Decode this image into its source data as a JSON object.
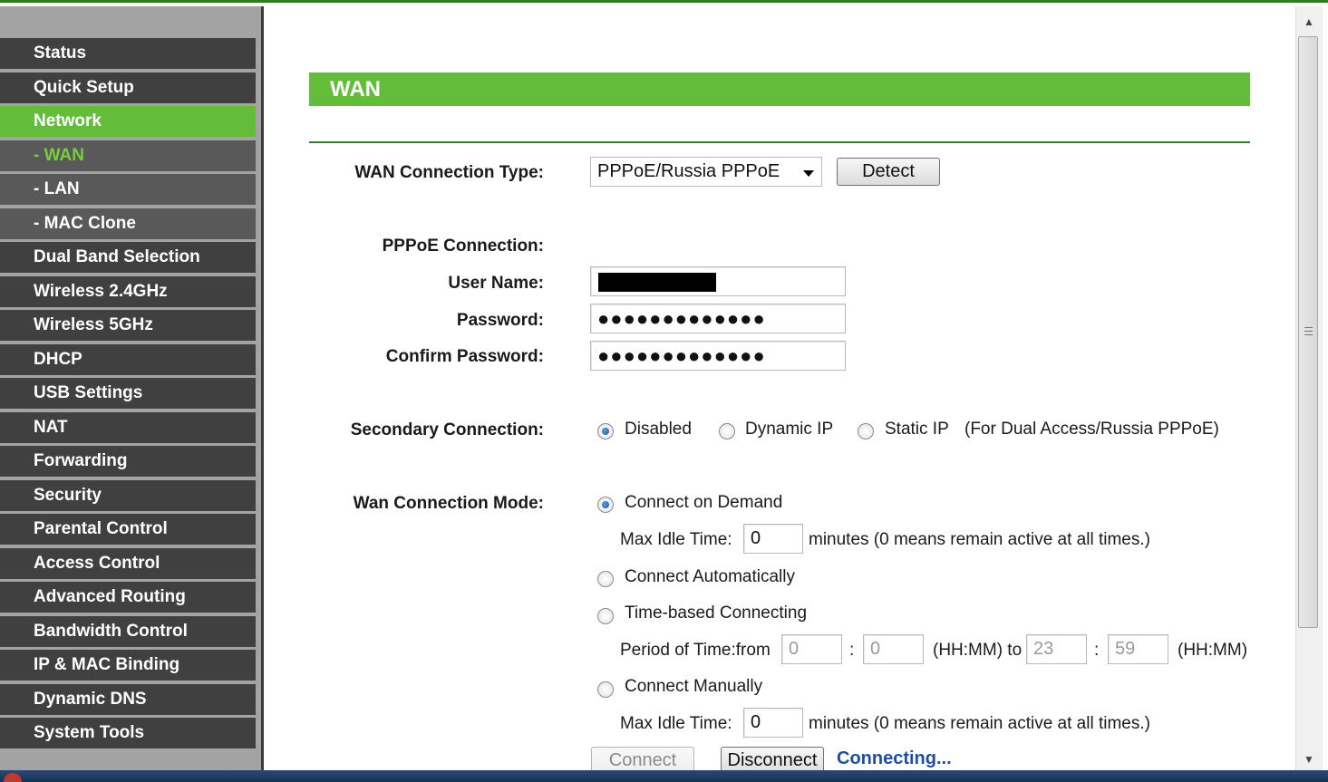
{
  "sidebar": {
    "items": [
      {
        "label": "Status"
      },
      {
        "label": "Quick Setup"
      },
      {
        "label": "Network",
        "state": "active"
      },
      {
        "label": "- WAN",
        "state": "current-sub"
      },
      {
        "label": "- LAN"
      },
      {
        "label": "- MAC Clone"
      },
      {
        "label": "Dual Band Selection"
      },
      {
        "label": "Wireless 2.4GHz"
      },
      {
        "label": "Wireless 5GHz"
      },
      {
        "label": "DHCP"
      },
      {
        "label": "USB Settings"
      },
      {
        "label": "NAT"
      },
      {
        "label": "Forwarding"
      },
      {
        "label": "Security"
      },
      {
        "label": "Parental Control"
      },
      {
        "label": "Access Control"
      },
      {
        "label": "Advanced Routing"
      },
      {
        "label": "Bandwidth Control"
      },
      {
        "label": "IP & MAC Binding"
      },
      {
        "label": "Dynamic DNS"
      },
      {
        "label": "System Tools"
      }
    ]
  },
  "page": {
    "title": "WAN",
    "wan_type_label": "WAN Connection Type:",
    "wan_type_value": "PPPoE/Russia PPPoE",
    "detect_button": "Detect",
    "pppoe_label": "PPPoE Connection:",
    "username_label": "User Name:",
    "password_label": "Password:",
    "password_value": "●●●●●●●●●●●●●",
    "confirm_label": "Confirm Password:",
    "confirm_value": "●●●●●●●●●●●●●",
    "secondary_label": "Secondary Connection:",
    "secondary_options": [
      "Disabled",
      "Dynamic IP",
      "Static IP"
    ],
    "secondary_selected": "Disabled",
    "secondary_note": "(For Dual Access/Russia PPPoE)",
    "mode_label": "Wan Connection Mode:",
    "mode_options": [
      "Connect on Demand",
      "Connect Automatically",
      "Time-based Connecting",
      "Connect Manually"
    ],
    "mode_selected": "Connect on Demand",
    "max_idle_label": "Max Idle Time:",
    "max_idle_value_1": "0",
    "max_idle_value_2": "0",
    "minutes_note": "minutes (0 means remain active at all times.)",
    "period_label": "Period of Time:from",
    "from_hh": "0",
    "from_mm": "0",
    "to_hh": "23",
    "to_mm": "59",
    "colon": ":",
    "hhmm_to": "(HH:MM) to",
    "hhmm": "(HH:MM)",
    "connect_button": "Connect",
    "disconnect_button": "Disconnect",
    "status_text": "Connecting..."
  },
  "colors": {
    "accent_green": "#63bc3a",
    "menu_dark": "#404040",
    "status_blue": "#1f4f9e"
  },
  "icons": {
    "select_arrow": "chevron-down-icon",
    "scroll_up": "scroll-up-arrow-icon",
    "scroll_down": "scroll-down-arrow-icon"
  }
}
